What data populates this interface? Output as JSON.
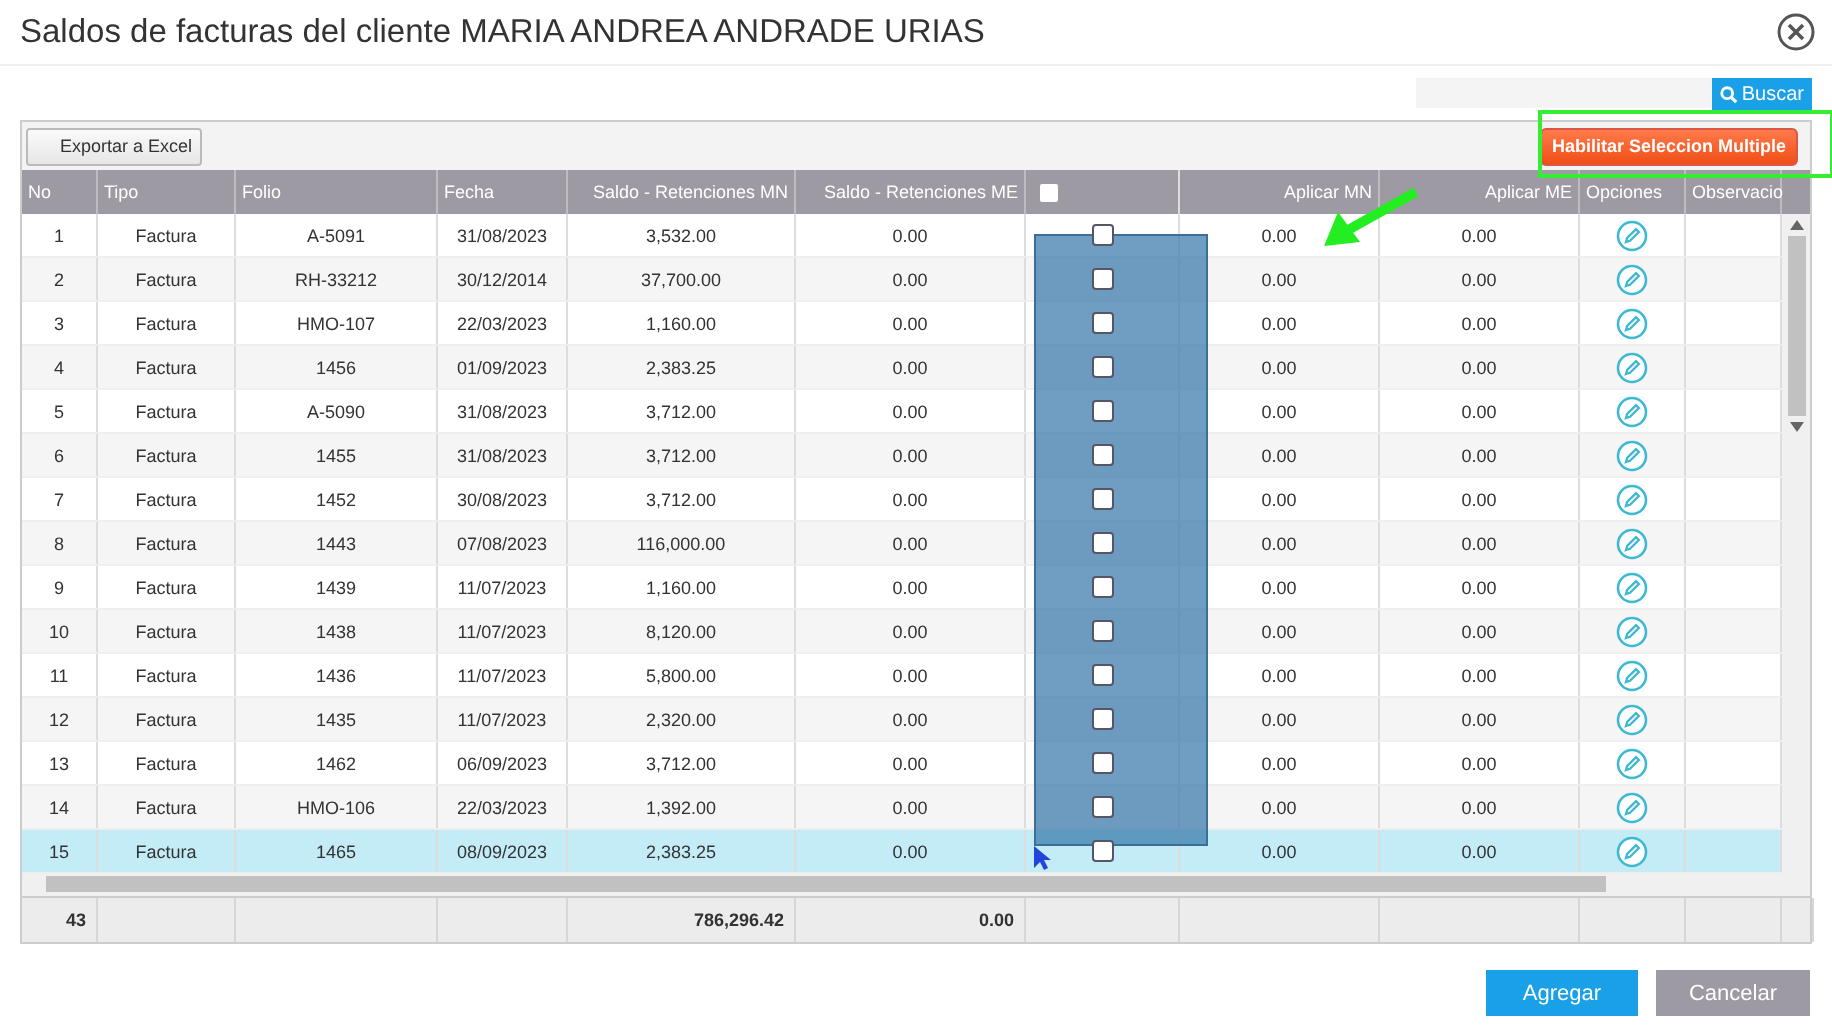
{
  "window": {
    "title": "Saldos de facturas del cliente MARIA ANDREA ANDRADE URIAS"
  },
  "search": {
    "button": "Buscar"
  },
  "toolbar": {
    "export_button": "Exportar a Excel",
    "multi_select_button": "Habilitar Seleccion Multiple"
  },
  "table": {
    "columns": [
      "No",
      "Tipo",
      "Folio",
      "Fecha",
      "Saldo - Retenciones MN",
      "Saldo - Retenciones ME",
      "",
      "Aplicar MN",
      "Aplicar ME",
      "Opciones",
      "Observacio"
    ],
    "all_checked": false,
    "rows": [
      {
        "no": "1",
        "tipo": "Factura",
        "folio": "A-5091",
        "fecha": "31/08/2023",
        "saldo_mn": "3,532.00",
        "saldo_me": "0.00",
        "checked": false,
        "aplicar_mn": "0.00",
        "aplicar_me": "0.00",
        "selected": false
      },
      {
        "no": "2",
        "tipo": "Factura",
        "folio": "RH-33212",
        "fecha": "30/12/2014",
        "saldo_mn": "37,700.00",
        "saldo_me": "0.00",
        "checked": false,
        "aplicar_mn": "0.00",
        "aplicar_me": "0.00",
        "selected": false
      },
      {
        "no": "3",
        "tipo": "Factura",
        "folio": "HMO-107",
        "fecha": "22/03/2023",
        "saldo_mn": "1,160.00",
        "saldo_me": "0.00",
        "checked": false,
        "aplicar_mn": "0.00",
        "aplicar_me": "0.00",
        "selected": false
      },
      {
        "no": "4",
        "tipo": "Factura",
        "folio": "1456",
        "fecha": "01/09/2023",
        "saldo_mn": "2,383.25",
        "saldo_me": "0.00",
        "checked": false,
        "aplicar_mn": "0.00",
        "aplicar_me": "0.00",
        "selected": false
      },
      {
        "no": "5",
        "tipo": "Factura",
        "folio": "A-5090",
        "fecha": "31/08/2023",
        "saldo_mn": "3,712.00",
        "saldo_me": "0.00",
        "checked": false,
        "aplicar_mn": "0.00",
        "aplicar_me": "0.00",
        "selected": false
      },
      {
        "no": "6",
        "tipo": "Factura",
        "folio": "1455",
        "fecha": "31/08/2023",
        "saldo_mn": "3,712.00",
        "saldo_me": "0.00",
        "checked": false,
        "aplicar_mn": "0.00",
        "aplicar_me": "0.00",
        "selected": false
      },
      {
        "no": "7",
        "tipo": "Factura",
        "folio": "1452",
        "fecha": "30/08/2023",
        "saldo_mn": "3,712.00",
        "saldo_me": "0.00",
        "checked": false,
        "aplicar_mn": "0.00",
        "aplicar_me": "0.00",
        "selected": false
      },
      {
        "no": "8",
        "tipo": "Factura",
        "folio": "1443",
        "fecha": "07/08/2023",
        "saldo_mn": "116,000.00",
        "saldo_me": "0.00",
        "checked": false,
        "aplicar_mn": "0.00",
        "aplicar_me": "0.00",
        "selected": false
      },
      {
        "no": "9",
        "tipo": "Factura",
        "folio": "1439",
        "fecha": "11/07/2023",
        "saldo_mn": "1,160.00",
        "saldo_me": "0.00",
        "checked": false,
        "aplicar_mn": "0.00",
        "aplicar_me": "0.00",
        "selected": false
      },
      {
        "no": "10",
        "tipo": "Factura",
        "folio": "1438",
        "fecha": "11/07/2023",
        "saldo_mn": "8,120.00",
        "saldo_me": "0.00",
        "checked": false,
        "aplicar_mn": "0.00",
        "aplicar_me": "0.00",
        "selected": false
      },
      {
        "no": "11",
        "tipo": "Factura",
        "folio": "1436",
        "fecha": "11/07/2023",
        "saldo_mn": "5,800.00",
        "saldo_me": "0.00",
        "checked": false,
        "aplicar_mn": "0.00",
        "aplicar_me": "0.00",
        "selected": false
      },
      {
        "no": "12",
        "tipo": "Factura",
        "folio": "1435",
        "fecha": "11/07/2023",
        "saldo_mn": "2,320.00",
        "saldo_me": "0.00",
        "checked": false,
        "aplicar_mn": "0.00",
        "aplicar_me": "0.00",
        "selected": false
      },
      {
        "no": "13",
        "tipo": "Factura",
        "folio": "1462",
        "fecha": "06/09/2023",
        "saldo_mn": "3,712.00",
        "saldo_me": "0.00",
        "checked": false,
        "aplicar_mn": "0.00",
        "aplicar_me": "0.00",
        "selected": false
      },
      {
        "no": "14",
        "tipo": "Factura",
        "folio": "HMO-106",
        "fecha": "22/03/2023",
        "saldo_mn": "1,392.00",
        "saldo_me": "0.00",
        "checked": false,
        "aplicar_mn": "0.00",
        "aplicar_me": "0.00",
        "selected": false
      },
      {
        "no": "15",
        "tipo": "Factura",
        "folio": "1465",
        "fecha": "08/09/2023",
        "saldo_mn": "2,383.25",
        "saldo_me": "0.00",
        "checked": false,
        "aplicar_mn": "0.00",
        "aplicar_me": "0.00",
        "selected": true
      }
    ],
    "totals": {
      "count": "43",
      "saldo_mn": "786,296.42",
      "saldo_me": "0.00"
    }
  },
  "buttons": [
    "Agregar",
    "Cancelar"
  ]
}
